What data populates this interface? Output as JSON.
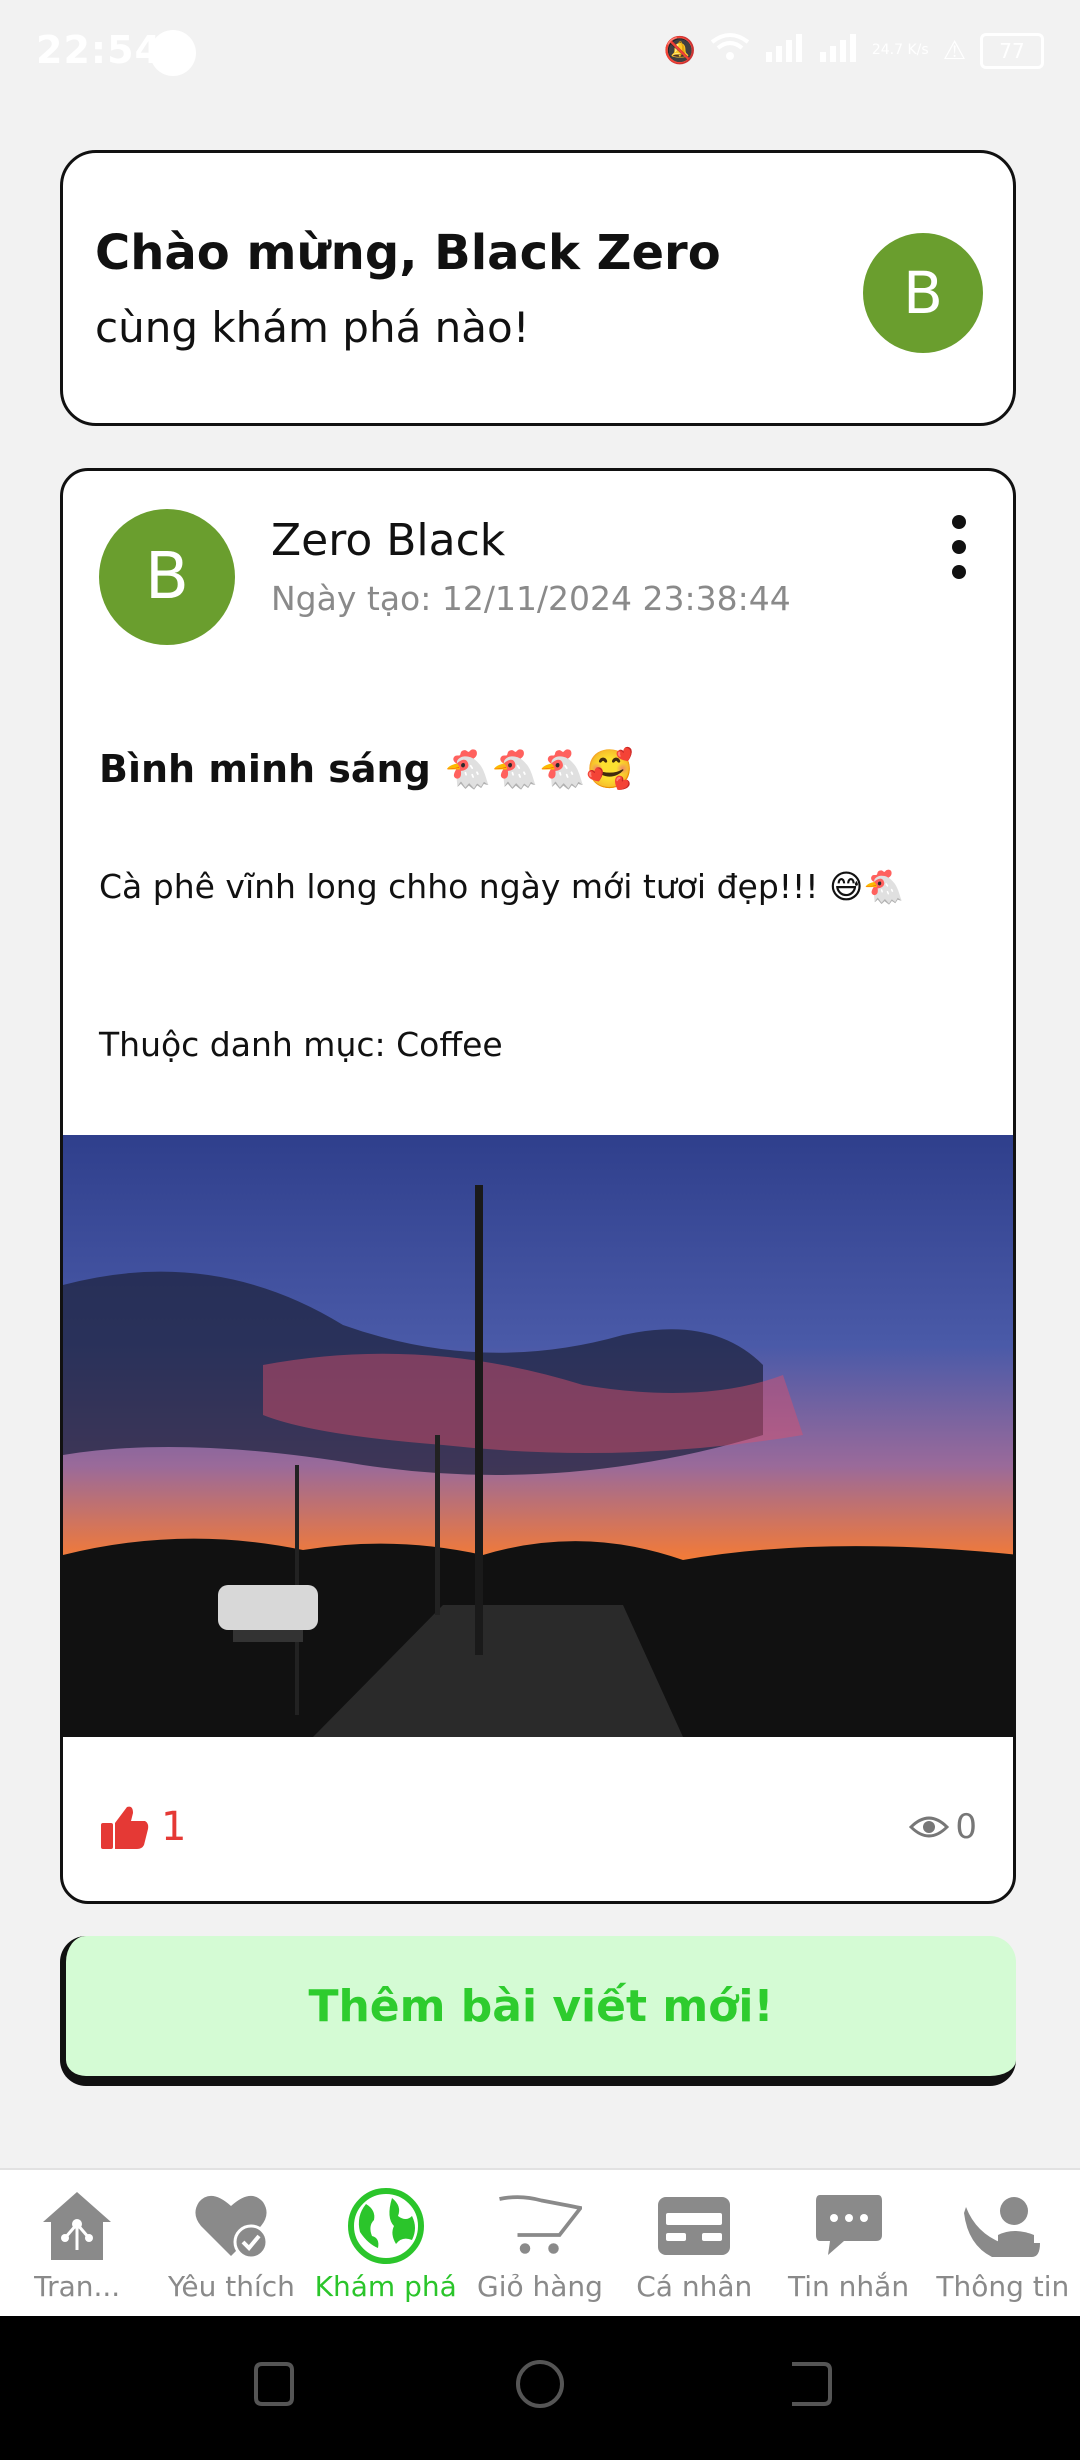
{
  "status_bar": {
    "time": "22:54",
    "net_speed": "24.7 K/s",
    "battery": "77"
  },
  "welcome": {
    "title": "Chào mừng, Black Zero",
    "subtitle": "cùng khám phá nào!",
    "avatar_letter": "B"
  },
  "post": {
    "avatar_letter": "B",
    "author": "Zero Black",
    "date": "Ngày tạo: 12/11/2024 23:38:44",
    "title": "Bình minh sáng 🐔🐔🐔🥰",
    "body": "Cà phê vĩnh long chho ngày mới tươi đẹp!!! 😅🐔",
    "category": "Thuộc danh mục: Coffee",
    "likes": "1",
    "views": "0"
  },
  "new_post_label": "Thêm bài viết mới!",
  "nav": {
    "items": [
      {
        "label": "Tran...",
        "icon": "home-network-icon"
      },
      {
        "label": "Yêu thích",
        "icon": "heart-check-icon"
      },
      {
        "label": "Khám phá",
        "icon": "globe-icon",
        "active": true
      },
      {
        "label": "Giỏ hàng",
        "icon": "cart-icon"
      },
      {
        "label": "Cá nhân",
        "icon": "card-icon"
      },
      {
        "label": "Tin nhắn",
        "icon": "chat-icon"
      },
      {
        "label": "Thông tin",
        "icon": "user-icon"
      }
    ]
  },
  "colors": {
    "avatar": "#6a9e2e",
    "accent_green": "#2bc52b",
    "like_red": "#e53935",
    "button_bg": "#d4fbd4"
  }
}
